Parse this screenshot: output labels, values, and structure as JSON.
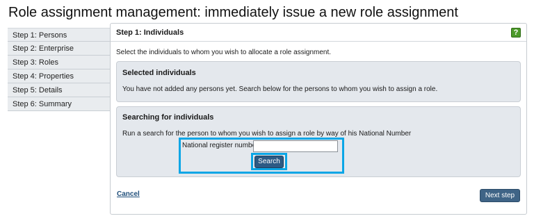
{
  "page": {
    "title": "Role assignment management: immediately issue a new role assignment"
  },
  "steps": [
    {
      "label": "Step 1: Persons"
    },
    {
      "label": "Step 2: Enterprise"
    },
    {
      "label": "Step 3: Roles"
    },
    {
      "label": "Step 4: Properties"
    },
    {
      "label": "Step 5: Details"
    },
    {
      "label": "Step 6: Summary"
    }
  ],
  "content": {
    "heading": "Step 1: Individuals",
    "help_icon": "help-icon",
    "help_glyph": "?",
    "intro": "Select the individuals to whom you wish to allocate a role assignment."
  },
  "selected_panel": {
    "title": "Selected individuals",
    "text": "You have not added any persons yet. Search below for the persons to whom you wish to assign a role."
  },
  "search_panel": {
    "title": "Searching for individuals",
    "text": "Run a search for the person to whom you wish to assign a role by way of his National Number",
    "field_label": "National register number",
    "field_value": "",
    "search_label": "Search"
  },
  "footer": {
    "cancel_label": "Cancel",
    "next_label": "Next step"
  },
  "colors": {
    "highlight": "#0aa6e6",
    "button": "#2d5a84",
    "panel_bg": "#e4e8ed",
    "help_green": "#4c9a2a"
  }
}
